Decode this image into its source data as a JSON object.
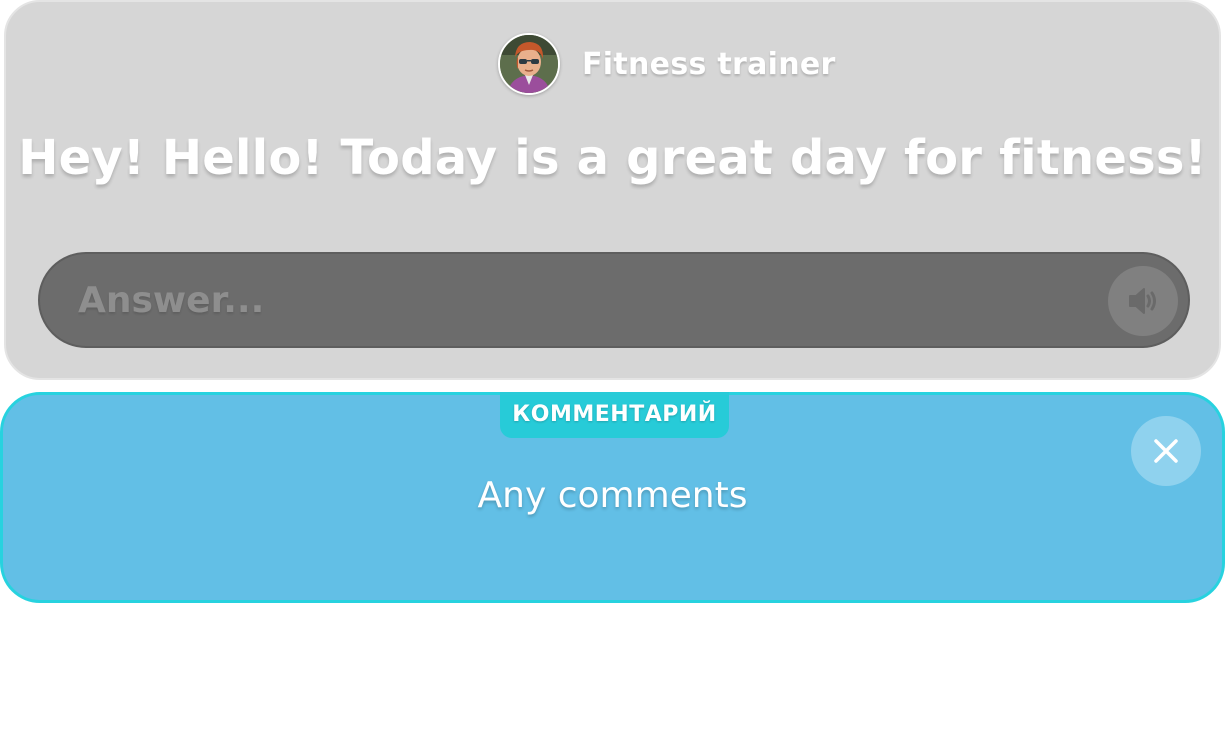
{
  "dialog": {
    "character_name": "Fitness trainer",
    "avatar_icon": "trainer-avatar",
    "message": "Hey! Hello! Today is a great day for fitness!",
    "answer_placeholder": "Answer...",
    "answer_value": "",
    "sound_icon": "speaker-icon"
  },
  "comment": {
    "tag_label": "КОММЕНТАРИЙ",
    "text": "Any comments",
    "close_icon": "close-icon"
  },
  "colors": {
    "card_bg": "#d6d6d6",
    "answer_bar_bg": "#6c6c6c",
    "comment_bg": "#62bfe6",
    "comment_border": "#27d2df",
    "tag_bg": "#27cbd8"
  }
}
